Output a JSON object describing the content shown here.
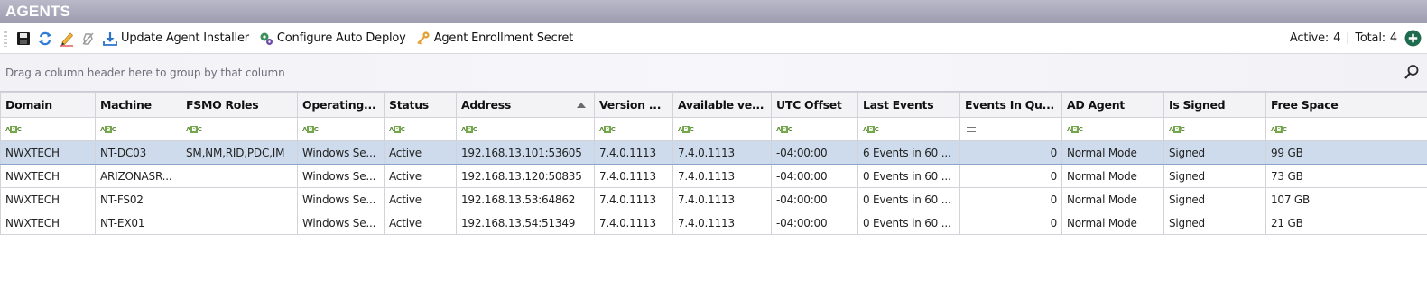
{
  "panel": {
    "title": "AGENTS"
  },
  "toolbar": {
    "icons": [
      "save-icon",
      "refresh-icon",
      "edit-icon",
      "remove-icon",
      "download-icon",
      "gear-icon",
      "key-icon"
    ],
    "update_installer_label": "Update Agent Installer",
    "configure_deploy_label": "Configure Auto Deploy",
    "enrollment_secret_label": "Agent Enrollment Secret",
    "active_label": "Active:",
    "active_count": "4",
    "separator": "|",
    "total_label": "Total:",
    "total_count": "4",
    "add_icon": "add-icon"
  },
  "grid": {
    "group_hint": "Drag a column header here to group by that column",
    "search_icon": "search-icon",
    "columns": [
      "Domain",
      "Machine",
      "FSMO Roles",
      "Operating...",
      "Status",
      "Address",
      "Version ...",
      "Available ve...",
      "UTC Offset",
      "Last Events",
      "Events In Qu...",
      "AD Agent",
      "Is Signed",
      "Free Space"
    ],
    "sorted_column": "Address",
    "sort_direction": "ascending",
    "filter_icons": [
      "abc",
      "abc",
      "abc",
      "abc",
      "abc",
      "abc",
      "abc",
      "abc",
      "abc",
      "abc",
      "equals",
      "abc",
      "abc",
      "abc"
    ],
    "rows": [
      [
        "NWXTECH",
        "NT-DC03",
        "SM,NM,RID,PDC,IM",
        "Windows Se...",
        "Active",
        "192.168.13.101:53605",
        "7.4.0.1113",
        "7.4.0.1113",
        "-04:00:00",
        "6 Events in 60 ...",
        "0",
        "Normal Mode",
        "Signed",
        "99 GB"
      ],
      [
        "NWXTECH",
        "ARIZONASR...",
        "",
        "Windows Se...",
        "Active",
        "192.168.13.120:50835",
        "7.4.0.1113",
        "7.4.0.1113",
        "-04:00:00",
        "0 Events in 60 ...",
        "0",
        "Normal Mode",
        "Signed",
        "73 GB"
      ],
      [
        "NWXTECH",
        "NT-FS02",
        "",
        "Windows Se...",
        "Active",
        "192.168.13.53:64862",
        "7.4.0.1113",
        "7.4.0.1113",
        "-04:00:00",
        "0 Events in 60 ...",
        "0",
        "Normal Mode",
        "Signed",
        "107 GB"
      ],
      [
        "NWXTECH",
        "NT-EX01",
        "",
        "Windows Se...",
        "Active",
        "192.168.13.54:51349",
        "7.4.0.1113",
        "7.4.0.1113",
        "-04:00:00",
        "0 Events in 60 ...",
        "0",
        "Normal Mode",
        "Signed",
        "21 GB"
      ]
    ],
    "selected_row": 0
  },
  "colors": {
    "title_bar": "#a9a9bb",
    "selection": "#cddbec",
    "status_active": "#1e8a2e"
  }
}
